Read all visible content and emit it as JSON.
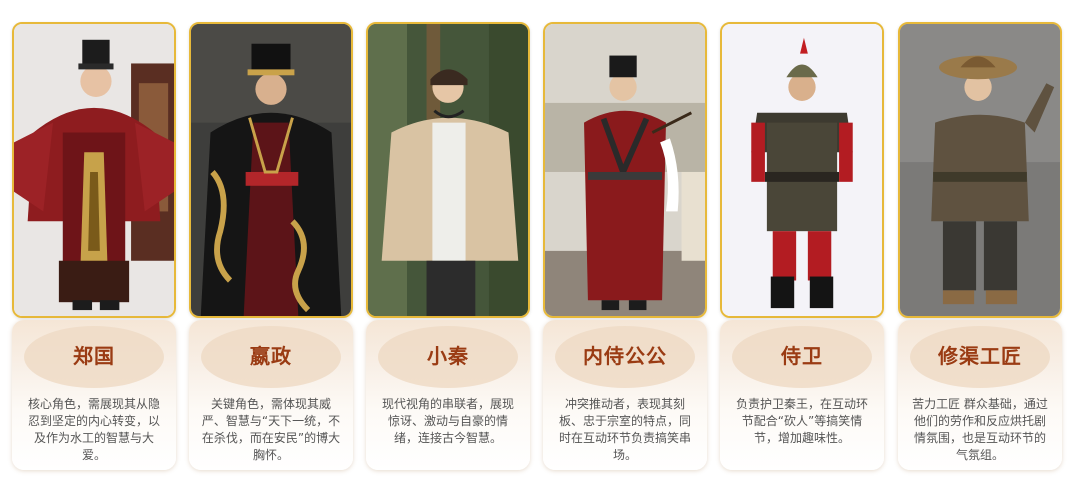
{
  "characters": [
    {
      "name": "郑国",
      "desc": "核心角色，需展现其从隐忍到坚定的内心转变，以及作为水工的智慧与大爱。",
      "photo": "red-robed-official-photo"
    },
    {
      "name": "嬴政",
      "desc": "关键角色，需体现其威严、智慧与“天下一统，不在杀伐，而在安民”的博大胸怀。",
      "photo": "black-dragon-robed-emperor-photo"
    },
    {
      "name": "小秦",
      "desc": "现代视角的串联者，展现惊讶、激动与自豪的情绪，连接古今智慧。",
      "photo": "modern-youth-photo"
    },
    {
      "name": "内侍公公",
      "desc": "冲突推动者，表现其刻板、忠于宗室的特点，同时在互动环节负责搞笑串场。",
      "photo": "eunuch-with-whisk-photo"
    },
    {
      "name": "侍卫",
      "desc": "负责护卫秦王，在互动环节配合“砍人”等搞笑情节，增加趣味性。",
      "photo": "armored-guard-photo"
    },
    {
      "name": "修渠工匠",
      "desc": "苦力工匠 群众基础，通过他们的劳作和反应烘托剧情氛围，也是互动环节的气氛组。",
      "photo": "laborer-with-straw-hat-photo"
    }
  ]
}
